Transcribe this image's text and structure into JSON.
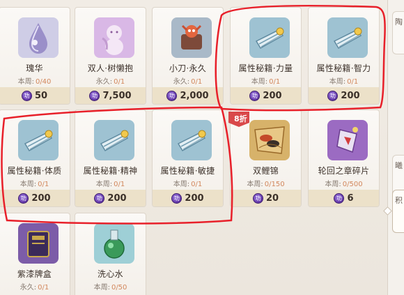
{
  "shop": {
    "week_prefix": "本周:",
    "perm_prefix": "永久:",
    "items": [
      {
        "name": "瑰华",
        "limit_type": "本周:",
        "limit": "0/40",
        "price": "50"
      },
      {
        "name": "双人·树懒抱",
        "limit_type": "永久:",
        "limit": "0/1",
        "price": "7,500"
      },
      {
        "name": "小刀·永久",
        "limit_type": "永久:",
        "limit": "0/1",
        "price": "2,000"
      },
      {
        "name": "属性秘籍·力量",
        "limit_type": "本周:",
        "limit": "0/1",
        "price": "200"
      },
      {
        "name": "属性秘籍·智力",
        "limit_type": "本周:",
        "limit": "0/1",
        "price": "200"
      },
      {
        "name": "属性秘籍·体质",
        "limit_type": "本周:",
        "limit": "0/1",
        "price": "200"
      },
      {
        "name": "属性秘籍·精神",
        "limit_type": "本周:",
        "limit": "0/1",
        "price": "200"
      },
      {
        "name": "属性秘籍·敏捷",
        "limit_type": "本周:",
        "limit": "0/1",
        "price": "200"
      },
      {
        "name": "双鲤锦",
        "limit_type": "本周:",
        "limit": "0/150",
        "price": "20"
      },
      {
        "name": "轮回之章碎片",
        "limit_type": "本周:",
        "limit": "0/500",
        "price": "6"
      },
      {
        "name": "紫漆牌盒",
        "limit_type": "永久:",
        "limit": "0/1",
        "price": ""
      },
      {
        "name": "洗心水",
        "limit_type": "本周:",
        "limit": "0/50",
        "price": ""
      }
    ],
    "discount_badge": "8折",
    "coin_glyph": "功"
  },
  "rail": {
    "tab_top": "陶",
    "tab_mid": "曦",
    "tab_bottom": "积"
  },
  "colors": {
    "annotation": "#e8202a",
    "count": "#d2875c",
    "price_bar": "#ece1c9",
    "coin": "#6a3fb0"
  },
  "icons": [
    "water-drop-icon",
    "sloth-hug-icon",
    "knife-pet-icon",
    "scroll-icon",
    "scroll-icon",
    "scroll-icon",
    "scroll-icon",
    "scroll-icon",
    "carp-brocade-icon",
    "chapter-shard-icon",
    "lacquer-box-icon",
    "potion-bottle-icon"
  ]
}
